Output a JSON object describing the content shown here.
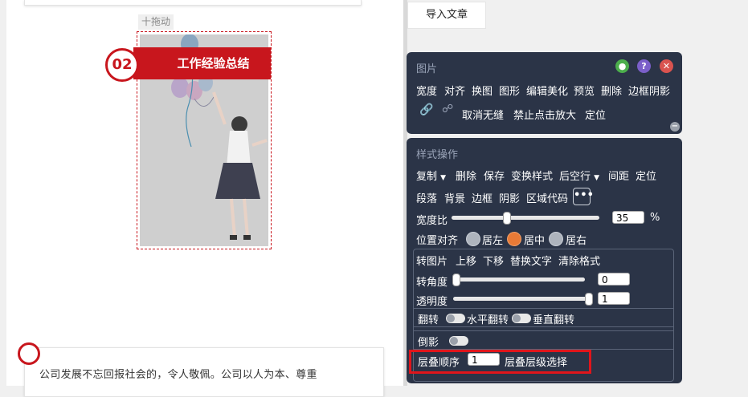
{
  "editor": {
    "drag_label": "十拖动",
    "section_number": "02",
    "section_title": "工作经验总结",
    "paragraph": "公司发展不忘回报社会的，令人敬佩。公司以人为本、尊重"
  },
  "import_button": "导入文章",
  "image_panel": {
    "title": "图片",
    "toolbar": [
      "宽度",
      "对齐",
      "换图",
      "图形",
      "编辑美化",
      "预览",
      "删除",
      "边框阴影"
    ],
    "row2": [
      "取消无缝",
      "禁止点击放大",
      "定位"
    ]
  },
  "style_panel": {
    "title": "样式操作",
    "row1": {
      "copy": "复制",
      "delete": "删除",
      "save": "保存",
      "transform": "变换样式",
      "after_blank": "后空行",
      "spacing": "间距",
      "position": "定位"
    },
    "row2": {
      "paragraph": "段落",
      "background": "背景",
      "border": "边框",
      "shadow": "阴影",
      "region_code": "区域代码",
      "more": "•••"
    },
    "width_ratio": {
      "label": "宽度比",
      "value": "35",
      "unit": "%",
      "level": 35
    },
    "align": {
      "label": "位置对齐",
      "options": [
        "居左",
        "居中",
        "居右"
      ],
      "selected": "居中"
    },
    "actions": {
      "convert": "转图片",
      "up": "上移",
      "down": "下移",
      "replace_text": "替换文字",
      "clear": "清除格式"
    },
    "rotate": {
      "label": "转角度",
      "value": "0",
      "level": 0
    },
    "opacity": {
      "label": "透明度",
      "value": "1",
      "level": 1
    },
    "flip": {
      "label": "翻转",
      "horizontal": "水平翻转",
      "vertical": "垂直翻转"
    },
    "reflection": {
      "label": "倒影"
    },
    "layer": {
      "label": "层叠顺序",
      "value": "1",
      "select": "层叠层级选择"
    }
  },
  "colors": {
    "accent_red": "#c8161d",
    "panel_bg": "#2b3447",
    "radio_on": "#e87a36"
  }
}
